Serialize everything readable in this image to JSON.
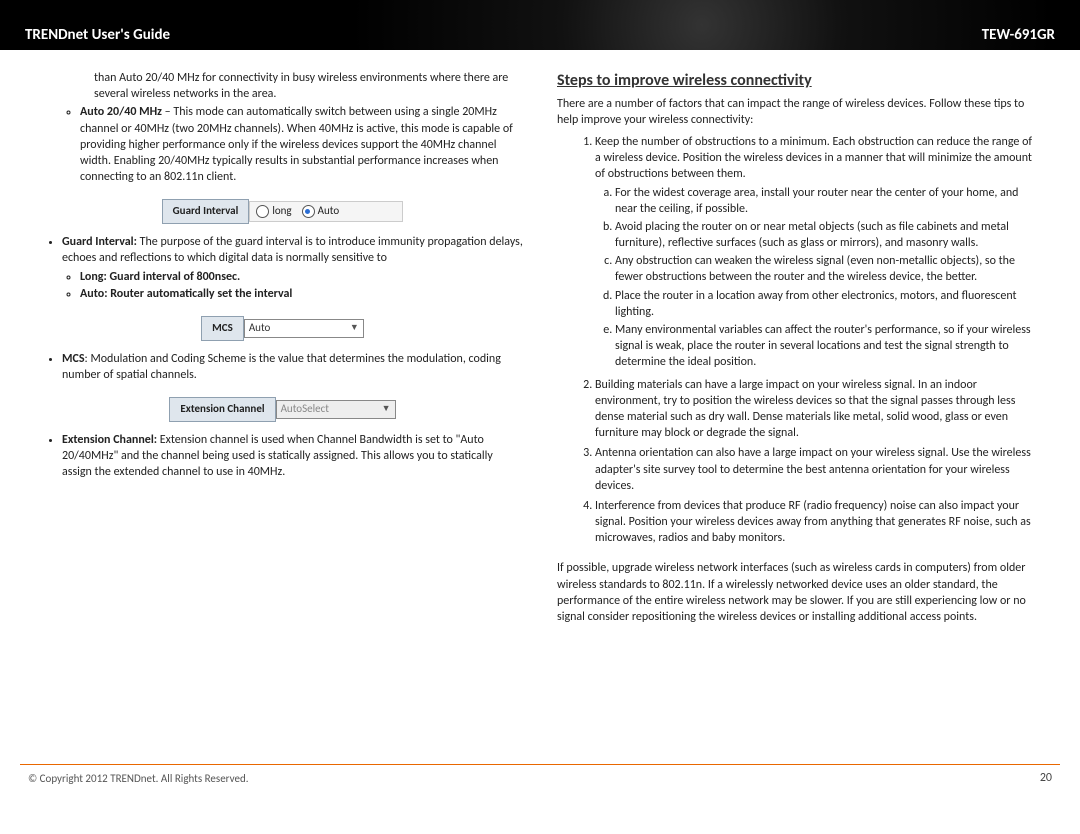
{
  "header": {
    "left": "TRENDnet User's Guide",
    "right": "TEW-691GR"
  },
  "left": {
    "blurb_top": "than Auto 20/40 MHz for connectivity in busy wireless environments where there are several wireless networks in the area.",
    "auto2040_label": "Auto 20/40 MHz",
    "auto2040_desc": " – This mode can automatically switch between using a single 20MHz channel or 40MHz (two 20MHz channels). When 40MHz is active, this mode is capable of providing higher performance only if the wireless devices support the 40MHz channel width. Enabling 20/40MHz typically results in substantial performance increases when connecting to an 802.11n client.",
    "guard_label": "Guard Interval",
    "guard_opts": [
      "long",
      "Auto"
    ],
    "guard_sel": 1,
    "guard_text": " The purpose of the guard interval is to introduce immunity propagation delays, echoes and reflections to which digital data is normally sensitive to",
    "guard_b1": "Long: Guard interval of 800nsec.",
    "guard_b2": "Auto: Router automatically set the interval",
    "mcs_label": "MCS",
    "mcs_value": "Auto",
    "mcs_text": ": Modulation and Coding Scheme is the value that determines the modulation, coding number of spatial channels.",
    "ext_label": "Extension Channel",
    "ext_value": "AutoSelect",
    "ext_text": " Extension channel is used when Channel Bandwidth is set to \"Auto 20/40MHz\" and the channel being used is statically assigned. This allows you to statically assign the extended channel to use in 40MHz."
  },
  "right": {
    "title": "Steps to improve wireless connectivity",
    "intro": "There are a number of factors that can impact the range of wireless devices. Follow these tips to help improve your wireless connectivity:",
    "tip1": "Keep the number of obstructions to a minimum. Each obstruction can reduce the range of a wireless device.  Position the wireless devices in a manner that will minimize the amount of obstructions between them.",
    "tips1a": [
      "For the widest coverage area, install your router near the center of your home, and near the ceiling, if possible.",
      "Avoid placing the router on or near metal objects (such as file cabinets and metal furniture), reflective surfaces (such as glass or mirrors), and masonry walls.",
      "Any obstruction can weaken the wireless signal (even non-metallic objects), so the fewer obstructions between the router and the wireless device, the better.",
      "Place the router in a location away from other electronics, motors, and fluorescent lighting.",
      "Many environmental variables can affect the router's performance, so if your wireless signal is weak, place the router in several locations and test the signal strength to determine the ideal position."
    ],
    "tip2": "Building materials can have a large impact on your wireless signal. In an indoor environment, try to position the wireless devices so that the signal passes through less dense material such as dry wall.  Dense materials like metal, solid wood, glass or even furniture may block or degrade the signal.",
    "tip3": "Antenna orientation can also have a large impact on your wireless signal. Use the wireless adapter's site survey tool to determine the best antenna orientation for your wireless devices.",
    "tip4": "Interference from devices that produce RF (radio frequency) noise can also impact your signal. Position your wireless devices away from anything that generates RF noise, such as microwaves, radios and baby monitors.",
    "closing": "If possible, upgrade wireless network interfaces (such as wireless cards in computers) from older wireless standards to 802.11n. If a wirelessly networked device uses an older standard, the performance of the entire wireless network may be slower. If you are still experiencing low or no signal consider repositioning the wireless devices or installing additional access points."
  },
  "footer": {
    "copy": "© Copyright 2012 TRENDnet. All Rights Reserved.",
    "page": "20"
  }
}
